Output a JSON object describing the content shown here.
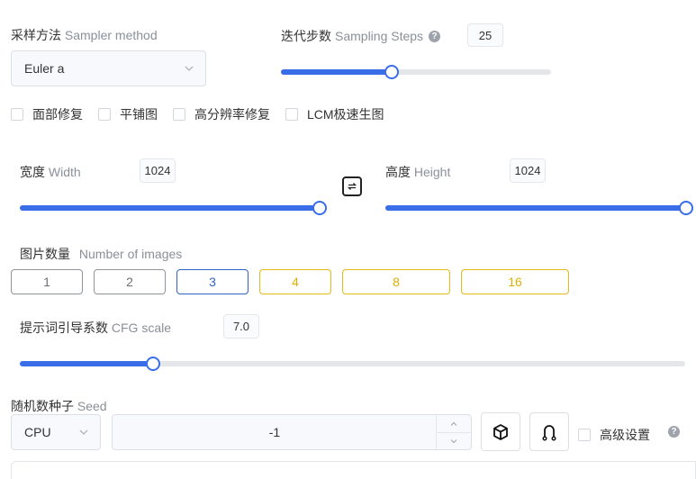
{
  "sampler": {
    "label_zh": "采样方法",
    "label_en": "Sampler method",
    "value": "Euler a"
  },
  "steps": {
    "label_zh": "迭代步数",
    "label_en": "Sampling Steps",
    "value": "25",
    "fraction": 0.41
  },
  "options": [
    {
      "label": "面部修复",
      "checked": false
    },
    {
      "label": "平铺图",
      "checked": false
    },
    {
      "label": "高分辨率修复",
      "checked": false
    },
    {
      "label": "LCM极速生图",
      "checked": false
    }
  ],
  "width": {
    "label_zh": "宽度",
    "label_en": "Width",
    "value": "1024",
    "fraction": 1.0
  },
  "height": {
    "label_zh": "高度",
    "label_en": "Height",
    "value": "1024",
    "fraction": 1.0
  },
  "num_images": {
    "label_zh": "图片数量",
    "label_en": "Number of images",
    "choices": [
      "1",
      "2",
      "3",
      "4",
      "8",
      "16"
    ],
    "selected": "3"
  },
  "cfg": {
    "label_zh": "提示词引导系数",
    "label_en": "CFG scale",
    "value": "7.0",
    "fraction": 0.2
  },
  "seed": {
    "label_zh": "随机数种子",
    "label_en": "Seed",
    "device": "CPU",
    "value": "-1"
  },
  "advanced": {
    "label": "高级设置",
    "checked": false
  },
  "colors": {
    "accent": "#3a6ee8",
    "selected_border": "#2f63c8",
    "premium_border": "#e6b818"
  }
}
